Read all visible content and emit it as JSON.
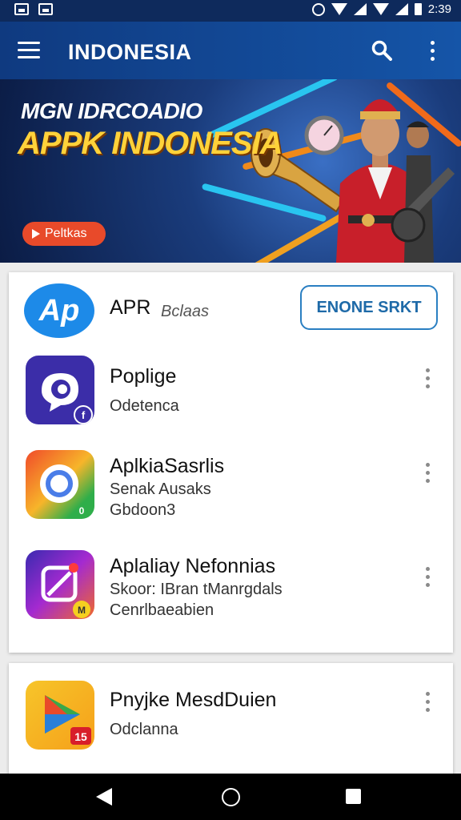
{
  "status_bar": {
    "time": "2:39"
  },
  "app_bar": {
    "title": "INDONESIA"
  },
  "banner": {
    "line1": "MGN IDRCOADIO",
    "line2": "APPK INDONESIA",
    "button_label": "Peltkas"
  },
  "featured": {
    "logo_text": "Ap",
    "name": "APR",
    "subtitle": "Bclaas",
    "button_label": "ENONE SRKT"
  },
  "apps": [
    {
      "title": "Poplige",
      "lines": [
        "Odetenca"
      ],
      "badge": "f"
    },
    {
      "title": "AplkiaSasrlis",
      "lines": [
        "Senak Ausaks",
        "Gbdoon3"
      ],
      "badge": "0"
    },
    {
      "title": "Aplaliay Nefonnias",
      "lines": [
        "Skoor: IBran tManrgdals",
        "Cenrlbaeabien"
      ],
      "badge": "M"
    }
  ],
  "bottom_app": {
    "title": "Pnyjke MesdDuien",
    "lines": [
      "Odclanna"
    ],
    "badge": "15"
  },
  "colors": {
    "app_bar": "#1555a8",
    "banner_accent": "#ffd23a",
    "button_outline": "#2a7fc2",
    "banner_button": "#e84a2a"
  }
}
